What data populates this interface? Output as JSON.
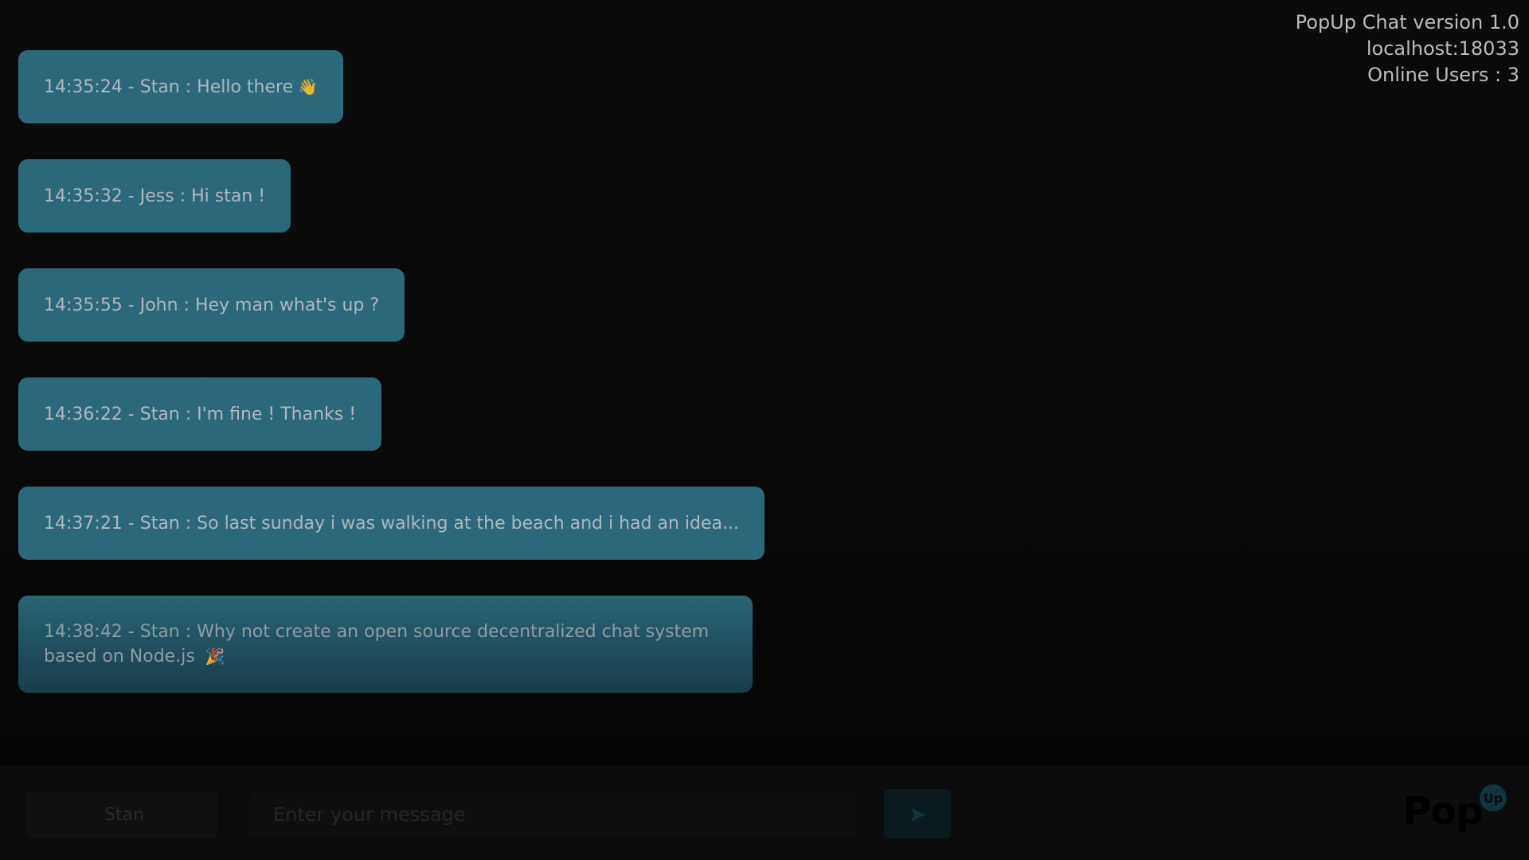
{
  "header": {
    "version": "PopUp Chat version 1.0",
    "host": "localhost:18033",
    "online_users": "Online Users : 3"
  },
  "messages": [
    {
      "text": "14:35:24 - Stan : Hello there",
      "emoji": "👋"
    },
    {
      "text": "14:35:32 - Jess : Hi stan !",
      "emoji": ""
    },
    {
      "text": "14:35:55 - John : Hey man what's up ?",
      "emoji": ""
    },
    {
      "text": "14:36:22 - Stan : I'm fine ! Thanks !",
      "emoji": ""
    },
    {
      "text": "14:37:21 - Stan : So last sunday i was walking at the beach and i had an idea...",
      "emoji": ""
    },
    {
      "text": "14:38:42 - Stan : Why not create an open source decentralized chat system based on Node.js",
      "emoji": "🎉"
    }
  ],
  "composer": {
    "username": "Stan",
    "placeholder": "Enter your message",
    "send_icon": "send-arrow-icon"
  },
  "logo": {
    "main": "Pop",
    "badge": "Up"
  },
  "colors": {
    "background": "#070707",
    "bubble": "#2b6879",
    "bubble_text": "#aeb9bd",
    "info_text": "#bdbdbd"
  }
}
